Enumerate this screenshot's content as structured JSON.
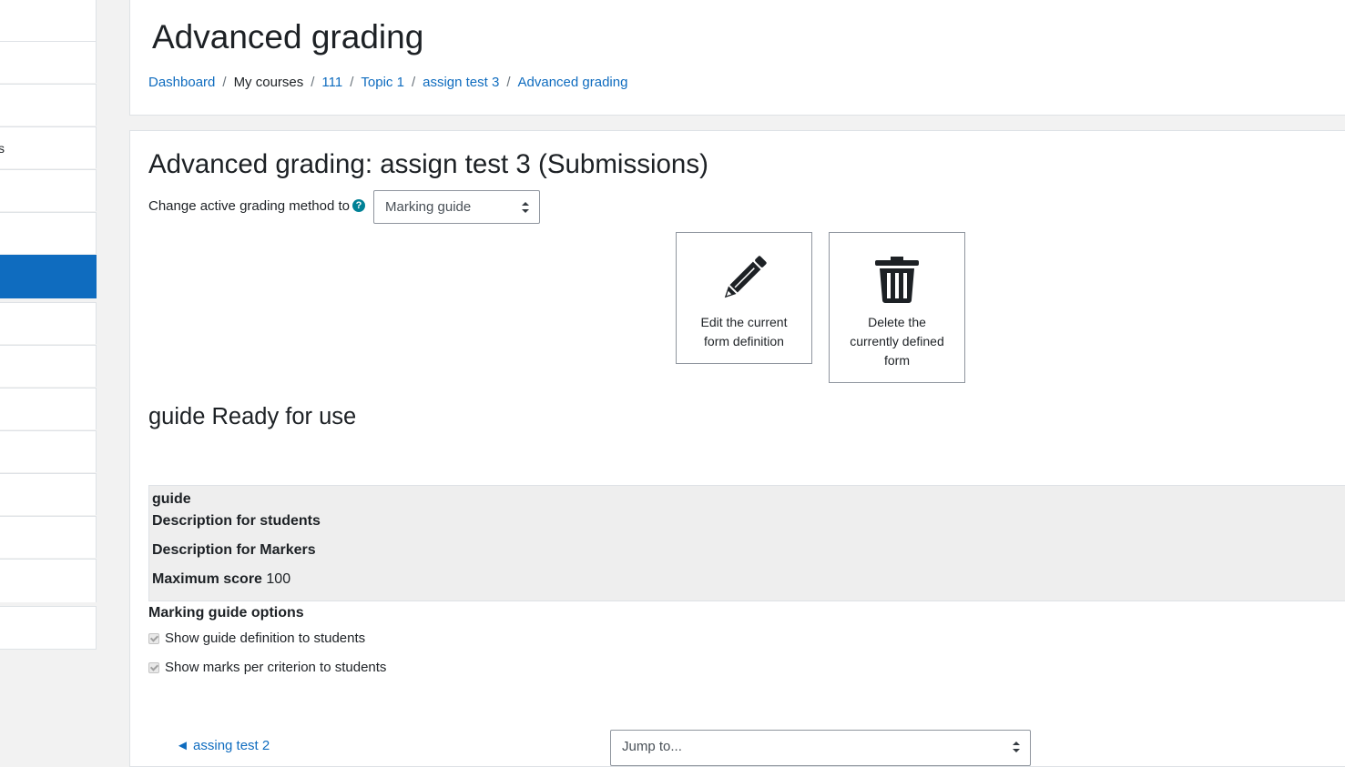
{
  "drawer": {
    "items": [
      {
        "label": ""
      },
      {
        "label": ""
      },
      {
        "label": ""
      },
      {
        "label": "s"
      },
      {
        "label": ""
      },
      {
        "label": ""
      },
      {
        "label": "",
        "active": true
      },
      {
        "label": ""
      },
      {
        "label": ""
      },
      {
        "label": ""
      },
      {
        "label": ""
      },
      {
        "label": ""
      },
      {
        "label": ""
      },
      {
        "label": ""
      },
      {
        "label": ""
      }
    ],
    "active_color": "#0f6cbf"
  },
  "header": {
    "title": "Advanced grading",
    "breadcrumb": [
      {
        "label": "Dashboard",
        "link": true
      },
      {
        "label": "My courses",
        "link": false
      },
      {
        "label": "111",
        "link": true
      },
      {
        "label": "Topic 1",
        "link": true
      },
      {
        "label": "assign test 3",
        "link": true
      },
      {
        "label": "Advanced grading",
        "link": true
      }
    ],
    "separator": "/"
  },
  "main": {
    "heading": "Advanced grading: assign test 3 (Submissions)",
    "method_label": "Change active grading method to",
    "help_icon": "question-circle-icon",
    "method_select": {
      "value": "Marking guide"
    },
    "actions": {
      "edit": {
        "label": "Edit the current form definition",
        "icon": "pencil-icon"
      },
      "delete": {
        "label": "Delete the currently defined form",
        "icon": "trash-icon"
      }
    },
    "status_heading": "guide Ready for use",
    "guide": {
      "name": "guide",
      "desc_students_label": "Description for students",
      "desc_markers_label": "Description for Markers",
      "max_score_label": "Maximum score",
      "max_score_value": "100"
    },
    "options": {
      "heading": "Marking guide options",
      "items": [
        {
          "label": "Show guide definition to students",
          "checked": true
        },
        {
          "label": "Show marks per criterion to students",
          "checked": true
        }
      ]
    },
    "footer_nav": {
      "prev_label": "◄ assing test 2",
      "jump_placeholder": "Jump to..."
    }
  }
}
